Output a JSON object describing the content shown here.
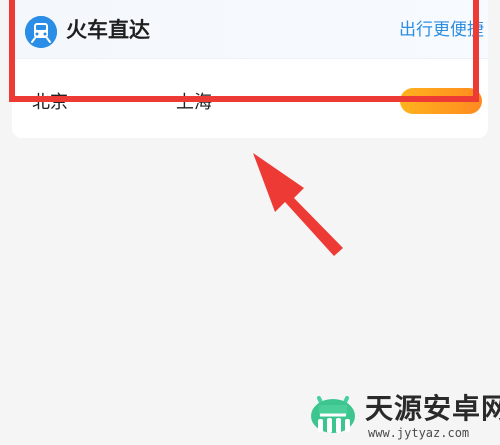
{
  "card": {
    "title": "火车直达",
    "subtitle": "出行更便捷",
    "from_station": "北京",
    "to_station": "上海",
    "button_label": "",
    "icon": "train-icon"
  },
  "annotation": {
    "highlight_color": "#ed3a34",
    "arrow_color": "#ed3a34"
  },
  "watermark": {
    "title": "天源安卓网",
    "url": "www.jytyaz.com",
    "logo": "android-logo-icon"
  },
  "colors": {
    "accent_blue": "#2d8ee0",
    "button_orange": "#ff9f1f",
    "background": "#f5f5f5"
  }
}
